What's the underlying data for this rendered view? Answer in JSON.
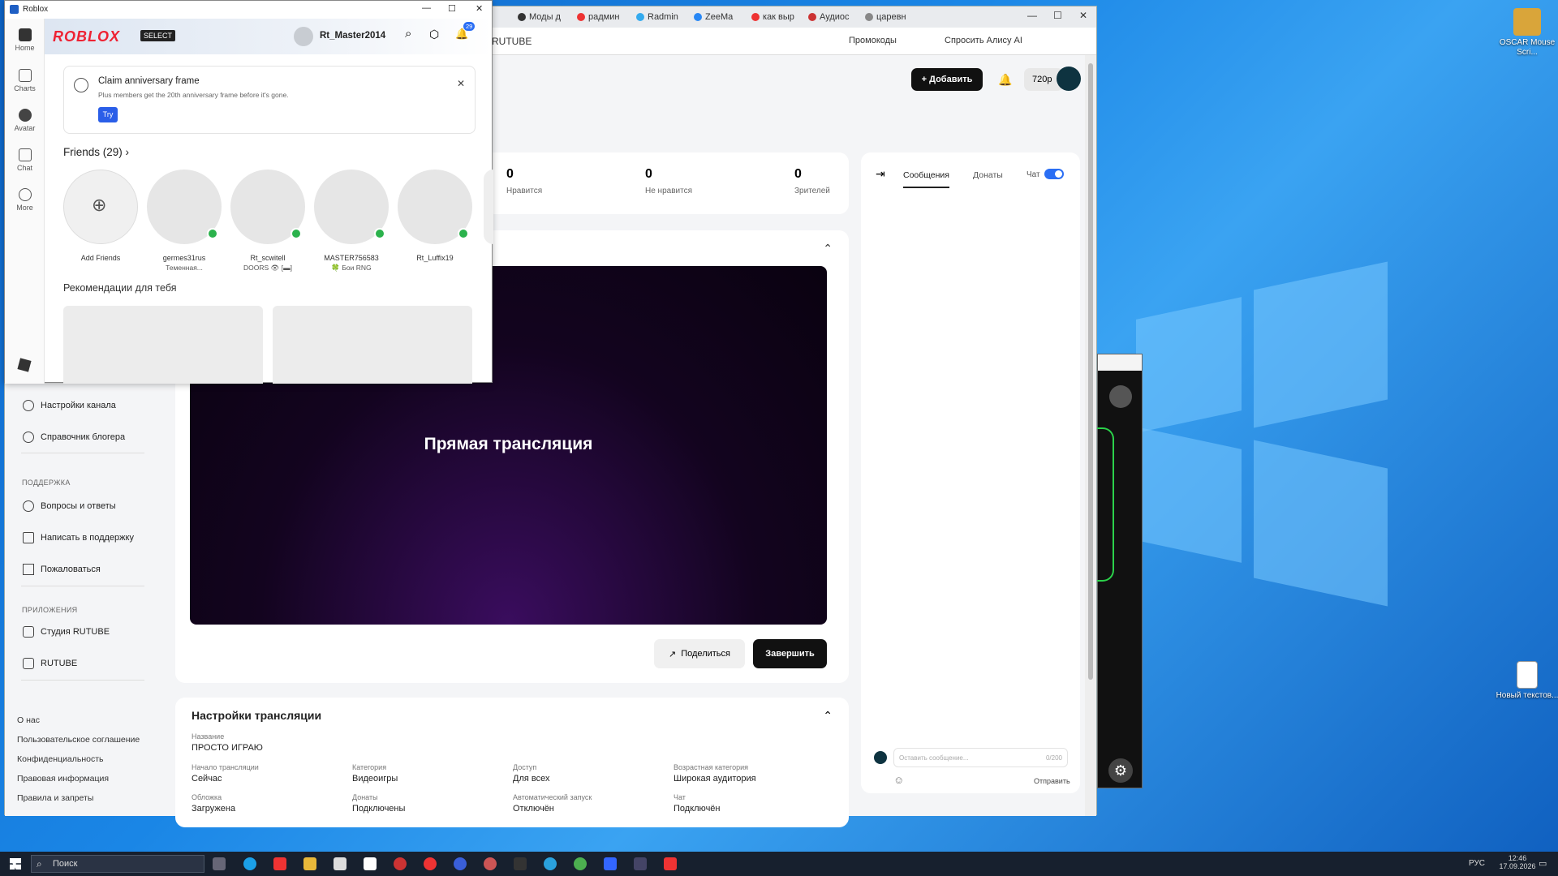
{
  "desktop": {
    "icons": [
      {
        "label": "OSCAR Mouse Scri...",
        "color": "#d9a53a"
      },
      {
        "label": "Новый текстов...",
        "color": "#ffffff"
      }
    ]
  },
  "browser": {
    "tabs": [
      "Моды д",
      "радмин",
      "Radmin",
      "ZeeMa",
      "как выр",
      "Аудиос",
      "царевн"
    ],
    "url": "RUTUBE",
    "toolbar": {
      "promo": "Промокоды",
      "ask": "Спросить Алису AI",
      "add": "Добавить",
      "quality": "720p"
    },
    "stats": [
      {
        "value": "0",
        "label": "Нравится"
      },
      {
        "value": "0",
        "label": "Не нравится"
      },
      {
        "value": "0",
        "label": "Зрителей"
      }
    ],
    "player_title": "Прямая трансляция",
    "share": "Поделиться",
    "finish": "Завершить",
    "chat": {
      "tab_messages": "Сообщения",
      "tab_donations": "Донаты",
      "chat_label": "Чат",
      "placeholder": "Оставить сообщение...",
      "counter": "0/200",
      "send": "Отправить"
    },
    "sidebar": {
      "items_top": [
        "Настройки канала",
        "Справочник блогера"
      ],
      "support_head": "ПОДДЕРЖКА",
      "support": [
        "Вопросы и ответы",
        "Написать в поддержку",
        "Пожаловаться"
      ],
      "apps_head": "ПРИЛОЖЕНИЯ",
      "apps": [
        "Студия RUTUBE",
        "RUTUBE"
      ],
      "footer": [
        "О нас",
        "Пользовательское соглашение",
        "Конфиденциальность",
        "Правовая информация",
        "Правила и запреты"
      ]
    },
    "settings": {
      "title": "Настройки трансляции",
      "name_label": "Название",
      "name_value": "ПРОСТО ИГРАЮ",
      "fields": [
        {
          "label": "Начало трансляции",
          "value": "Сейчас"
        },
        {
          "label": "Категория",
          "value": "Видеоигры"
        },
        {
          "label": "Доступ",
          "value": "Для всех"
        },
        {
          "label": "Возрастная категория",
          "value": "Широкая аудитория"
        },
        {
          "label": "Обложка",
          "value": "Загружена"
        },
        {
          "label": "Донаты",
          "value": "Подключены"
        },
        {
          "label": "Автоматический запуск",
          "value": "Отключён"
        },
        {
          "label": "Чат",
          "value": "Подключён"
        }
      ]
    }
  },
  "roblox": {
    "window_title": "Roblox",
    "logo": "ROBLOX",
    "select": "SELECT",
    "username": "Rt_Master2014",
    "notif_count": "29",
    "nav": [
      "Home",
      "Charts",
      "Avatar",
      "Chat",
      "More"
    ],
    "banner": {
      "title": "Claim anniversary frame",
      "desc": "Plus members get the 20th anniversary frame before it's gone.",
      "try": "Try"
    },
    "friends_title": "Friends (29)",
    "friends": [
      {
        "name": "Add Friends",
        "status": ""
      },
      {
        "name": "germes31rus",
        "status": "Теменная..."
      },
      {
        "name": "Rt_scwitell",
        "status": "DOORS 👁 [▬]"
      },
      {
        "name": "MASTER756583",
        "status": "🍀 Бои RNG"
      },
      {
        "name": "Rt_Luffix19",
        "status": ""
      }
    ],
    "recommend_title": "Рекомендации для тебя"
  },
  "taskbar": {
    "search": "Поиск",
    "lang": "РУС",
    "time": "12:46",
    "date": "17.09.2026"
  }
}
